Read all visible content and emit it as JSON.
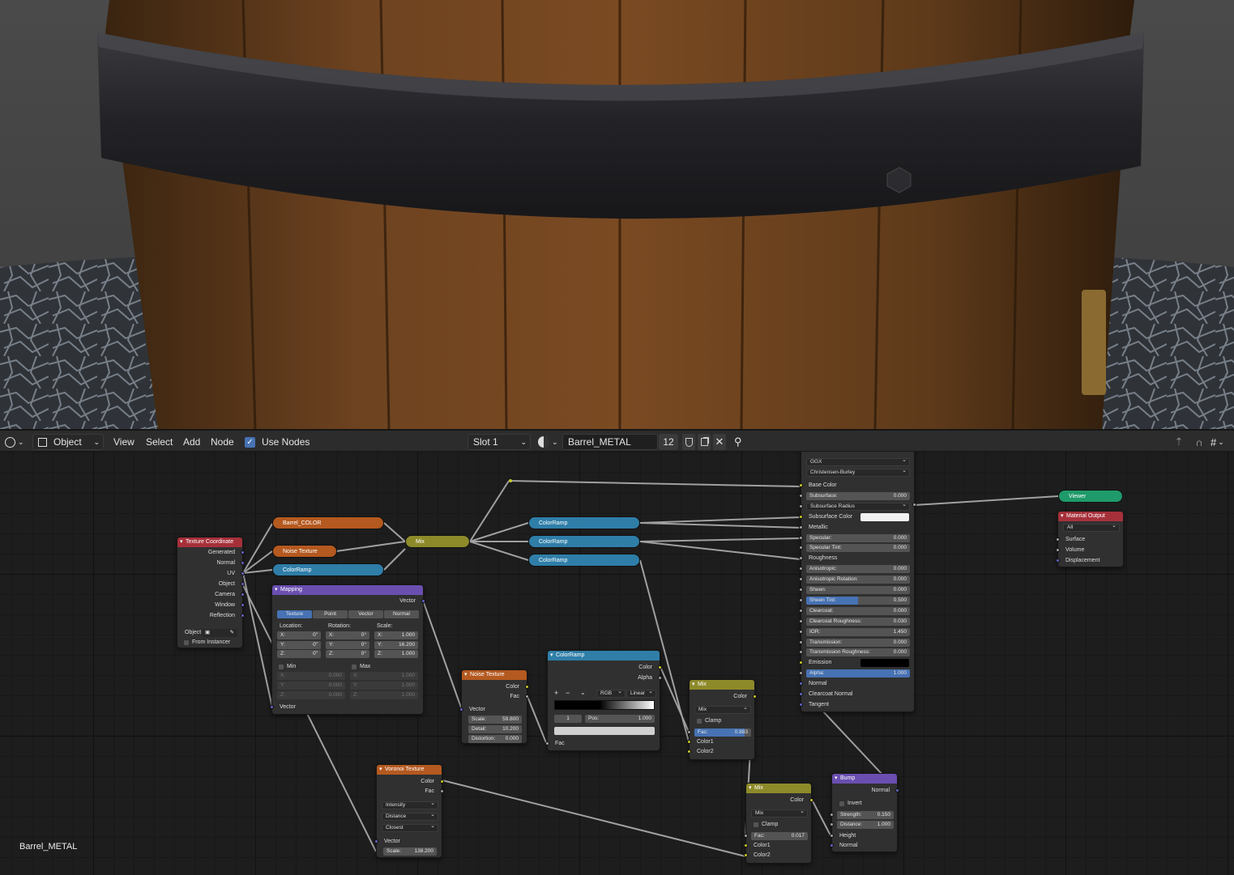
{
  "header": {
    "editor_type_icon": "node-editor-icon",
    "mode": "Object",
    "menus": [
      "View",
      "Select",
      "Add",
      "Node"
    ],
    "use_nodes_label": "Use Nodes",
    "use_nodes_checked": true,
    "slot": "Slot 1",
    "material_name": "Barrel_METAL",
    "user_count": "12"
  },
  "material_label": "Barrel_METAL",
  "nodes": {
    "texture_coordinate": {
      "title": "Texture Coordinate",
      "outputs": [
        "Generated",
        "Normal",
        "UV",
        "Object",
        "Camera",
        "Window",
        "Reflection"
      ],
      "object_label": "Object",
      "from_instancer": "From Instancer"
    },
    "barrel_color": "Barrel_COLOR",
    "noise_collapsed": "Noise Texture",
    "colorramp_collapsed": "ColorRamp",
    "mix_collapsed": "Mix",
    "colorramps_right": [
      "ColorRamp",
      "ColorRamp",
      "ColorRamp"
    ],
    "mapping": {
      "title": "Mapping",
      "output": "Vector",
      "tabs": [
        "Texture",
        "Point",
        "Vector",
        "Normal"
      ],
      "location": "Location:",
      "rotation": "Rotation:",
      "scale": "Scale:",
      "loc": [
        [
          "X:",
          "0\""
        ],
        [
          "Y:",
          "0\""
        ],
        [
          "Z:",
          "0\""
        ]
      ],
      "rot": [
        [
          "X:",
          "0°"
        ],
        [
          "Y:",
          "0°"
        ],
        [
          "Z:",
          "0°"
        ]
      ],
      "scl": [
        [
          "X:",
          "1.000"
        ],
        [
          "Y:",
          "16.200"
        ],
        [
          "Z:",
          "1.000"
        ]
      ],
      "min": "Min",
      "max": "Max",
      "minv": [
        [
          "X:",
          "0.000"
        ],
        [
          "Y:",
          "0.000"
        ],
        [
          "Z:",
          "0.000"
        ]
      ],
      "maxv": [
        [
          "X:",
          "1.000"
        ],
        [
          "Y:",
          "1.000"
        ],
        [
          "Z:",
          "1.000"
        ]
      ],
      "input": "Vector"
    },
    "noise": {
      "title": "Noise Texture",
      "outputs": [
        "Color",
        "Fac"
      ],
      "input": "Vector",
      "fields": [
        [
          "Scale:",
          "59.800"
        ],
        [
          "Detail:",
          "10.200"
        ],
        [
          "Distortion:",
          "0.000"
        ]
      ]
    },
    "colorramp": {
      "title": "ColorRamp",
      "outputs": [
        "Color",
        "Alpha"
      ],
      "mode": "RGB",
      "interp": "Linear",
      "index": "1",
      "pos_label": "Pos:",
      "pos": "1.000",
      "input": "Fac",
      "plus": "+",
      "minus": "−"
    },
    "voronoi": {
      "title": "Voronoi Texture",
      "outputs": [
        "Color",
        "Fac"
      ],
      "selects": [
        "Intensity",
        "Distance",
        "Closest"
      ],
      "input": "Vector",
      "scale_label": "Scale:",
      "scale": "138.200"
    },
    "mix1": {
      "title": "Mix",
      "output": "Color",
      "blend": "Mix",
      "clamp": "Clamp",
      "fac_label": "Fac:",
      "fac": "0.883",
      "fac_fraction": 0.883,
      "inputs": [
        "Color1",
        "Color2"
      ]
    },
    "mix2": {
      "title": "Mix",
      "output": "Color",
      "blend": "Mix",
      "clamp": "Clamp",
      "fac_label": "Fac:",
      "fac": "0.017",
      "inputs": [
        "Color1",
        "Color2"
      ]
    },
    "bump": {
      "title": "Bump",
      "output": "Normal",
      "invert": "Invert",
      "fields": [
        [
          "Strength:",
          "0.150"
        ],
        [
          "Distance:",
          "1.000"
        ]
      ],
      "inputs": [
        "Height",
        "Normal"
      ]
    },
    "principled": {
      "distribution": "GGX",
      "subsurface_method": "Christensen-Burley",
      "rows": [
        {
          "k": "label",
          "t": "Base Color"
        },
        {
          "k": "field",
          "t": "Subsurface:",
          "v": "0.000"
        },
        {
          "k": "select",
          "t": "Subsurface Radius"
        },
        {
          "k": "color",
          "t": "Subsurface Color",
          "c": "#f2f2f2"
        },
        {
          "k": "label",
          "t": "Metallic"
        },
        {
          "k": "field",
          "t": "Specular:",
          "v": "0.000"
        },
        {
          "k": "field",
          "t": "Specular Tint:",
          "v": "0.000"
        },
        {
          "k": "label",
          "t": "Roughness"
        },
        {
          "k": "field",
          "t": "Anisotropic:",
          "v": "0.000"
        },
        {
          "k": "field",
          "t": "Anisotropic Rotation:",
          "v": "0.000"
        },
        {
          "k": "field",
          "t": "Sheen:",
          "v": "0.000"
        },
        {
          "k": "field",
          "t": "Sheen Tint:",
          "v": "0.500",
          "f": 0.5
        },
        {
          "k": "field",
          "t": "Clearcoat:",
          "v": "0.000"
        },
        {
          "k": "field",
          "t": "Clearcoat Roughness:",
          "v": "0.030"
        },
        {
          "k": "field",
          "t": "IOR:",
          "v": "1.450"
        },
        {
          "k": "field",
          "t": "Transmission:",
          "v": "0.000"
        },
        {
          "k": "field",
          "t": "Transmission Roughness:",
          "v": "0.000"
        },
        {
          "k": "color",
          "t": "Emission",
          "c": "#000000"
        },
        {
          "k": "field",
          "t": "Alpha:",
          "v": "1.000",
          "f": 1
        },
        {
          "k": "label",
          "t": "Normal"
        },
        {
          "k": "label",
          "t": "Clearcoat Normal"
        },
        {
          "k": "label",
          "t": "Tangent"
        }
      ]
    },
    "viewer": "Viewer",
    "output": {
      "title": "Material Output",
      "target": "All",
      "inputs": [
        "Surface",
        "Volume",
        "Displacement"
      ]
    }
  }
}
